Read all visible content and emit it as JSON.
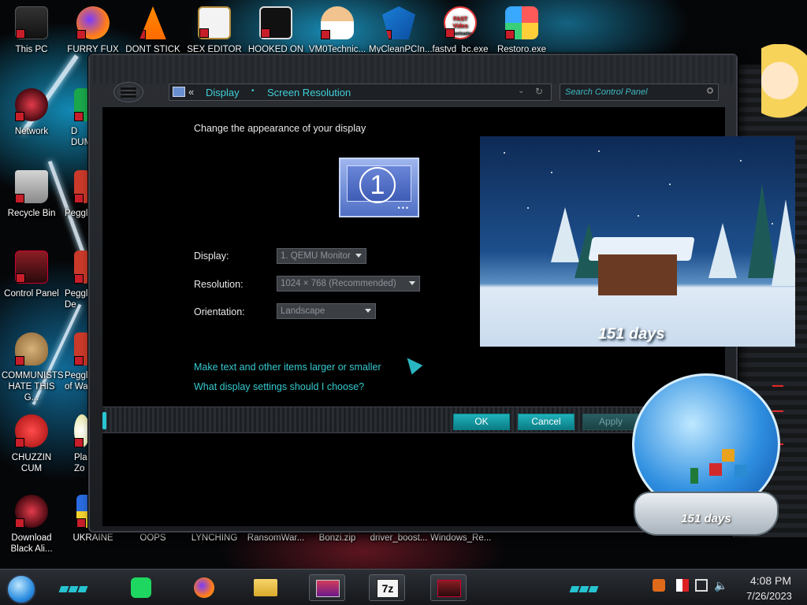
{
  "desktop": {
    "top_icons": [
      {
        "label": "This PC",
        "icon": "this-pc-icon"
      },
      {
        "label": "FURRY FUX",
        "icon": "firefox-icon"
      },
      {
        "label": "DONT STICK",
        "icon": "vlc-cone-icon"
      },
      {
        "label": "SEX EDITOR",
        "icon": "hxd-editor-icon"
      },
      {
        "label": "HOOKED ON",
        "icon": "maze-app-icon"
      },
      {
        "label": "VM0Technic...",
        "icon": "doctor-avatar-icon"
      },
      {
        "label": "MyCleanPCIn...",
        "icon": "blue-shield-icon"
      },
      {
        "label": "fastvd_bc.exe",
        "icon": "fast-video-downloader-icon"
      },
      {
        "label": "Restoro.exe",
        "icon": "restoro-cube-icon"
      }
    ],
    "fast_video_icon_text": [
      "FAST",
      "Video",
      "Downloader"
    ],
    "left_icons": [
      {
        "label": "Network",
        "icon": "network-orb-icon"
      },
      {
        "label": "Recycle Bin",
        "icon": "recycle-bin-icon"
      },
      {
        "label": "Control Panel",
        "icon": "control-panel-icon"
      },
      {
        "label": "COMMUNISTS HATE THIS G...",
        "icon": "money-bag-icon"
      },
      {
        "label": "CHUZZIN CUM",
        "icon": "chuzzle-icon"
      },
      {
        "label": "Download Black Ali...",
        "icon": "red-orb-icon"
      }
    ],
    "second_column_partial": [
      {
        "label": "D DUM",
        "icon": "app-icon"
      },
      {
        "label": "Peggle",
        "icon": "peggle-icon"
      },
      {
        "label": "Peggle De",
        "icon": "peggle-icon"
      },
      {
        "label": "Peggle of Wa",
        "icon": "peggle-icon"
      },
      {
        "label": "Plar Zo",
        "icon": "flower-icon"
      },
      {
        "label": "UKRAINE",
        "icon": "ukraine-icon"
      }
    ],
    "bottom_labels": [
      "OOPS",
      "LYNCHING",
      "RansomWar...",
      "Bonzi.zip",
      "driver_boost...",
      "Windows_Re..."
    ]
  },
  "window": {
    "breadcrumb": {
      "back_glyph": "«",
      "items": [
        "Display",
        "Screen Resolution"
      ],
      "separator_glyph": "•"
    },
    "search_placeholder": "Search Control Panel",
    "page_title": "Change the appearance of your display",
    "monitor_number": "1",
    "fields": {
      "display_label": "Display:",
      "display_value": "1. QEMU Monitor",
      "resolution_label": "Resolution:",
      "resolution_value": "1024 × 768 (Recommended)",
      "orientation_label": "Orientation:",
      "orientation_value": "Landscape"
    },
    "links": {
      "larger_text": "Make text and other items larger or smaller",
      "which_settings": "What display settings should I choose?"
    },
    "buttons": {
      "ok": "OK",
      "cancel": "Cancel",
      "apply": "Apply"
    }
  },
  "widgets": {
    "winter_days": "151 days",
    "globe_days": "151 days"
  },
  "taskbar": {
    "pinned": [
      {
        "icon": "spotify-icon"
      },
      {
        "icon": "firefox-icon"
      },
      {
        "icon": "file-explorer-icon"
      },
      {
        "icon": "monitor-app-icon",
        "active": true
      },
      {
        "icon": "7zip-icon",
        "label": "7z",
        "active": true
      },
      {
        "icon": "control-panel-icon",
        "active": true
      }
    ],
    "tray_icons": [
      "notification-icon",
      "flag-icon",
      "network-icon",
      "volume-icon"
    ],
    "time": "4:08 PM",
    "date": "7/26/2023"
  },
  "colors": {
    "accent": "#35c9cf",
    "button": "#1fb2bb",
    "window_bg": "#000000"
  }
}
